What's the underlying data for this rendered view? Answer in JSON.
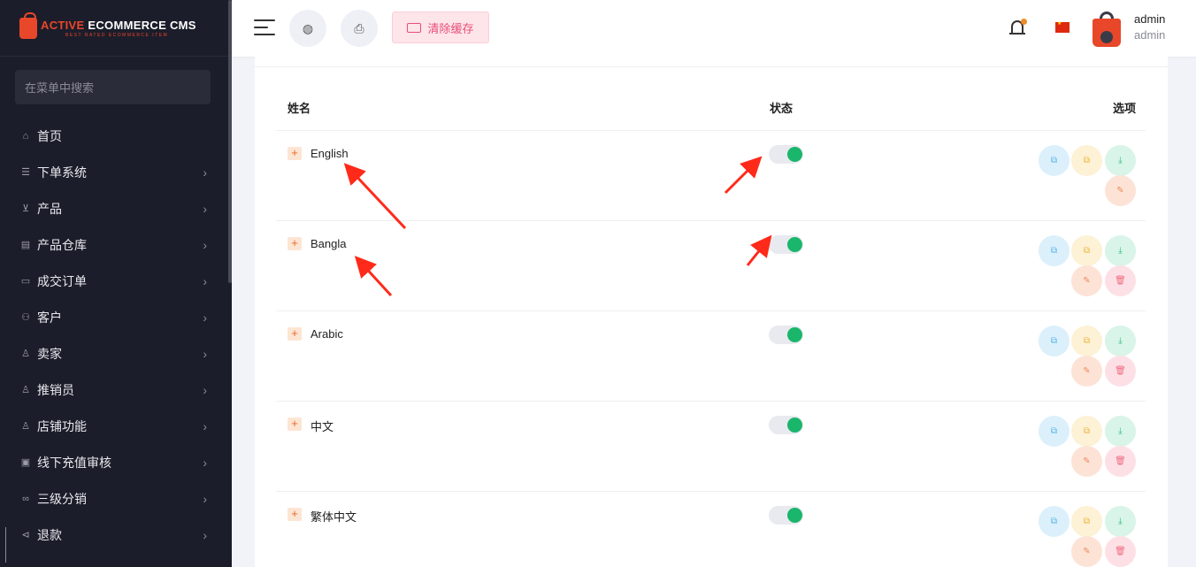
{
  "brand": {
    "title_part1": "ACTIVE ",
    "title_part2": "ECOMMERCE CMS",
    "subtitle": "BEST RATED ECOMMERCE ITEM"
  },
  "sidebar": {
    "search_placeholder": "在菜单中搜索",
    "items": [
      {
        "label": "首页",
        "icon": "home-icon",
        "has_children": false
      },
      {
        "label": "下单系统",
        "icon": "list-icon",
        "has_children": true
      },
      {
        "label": "产品",
        "icon": "cart-icon",
        "has_children": true
      },
      {
        "label": "产品仓库",
        "icon": "warehouse-icon",
        "has_children": true
      },
      {
        "label": "成交订单",
        "icon": "orders-icon",
        "has_children": true
      },
      {
        "label": "客户",
        "icon": "customers-icon",
        "has_children": true
      },
      {
        "label": "卖家",
        "icon": "user-icon",
        "has_children": true
      },
      {
        "label": "推销员",
        "icon": "user-icon",
        "has_children": true
      },
      {
        "label": "店铺功能",
        "icon": "user-icon",
        "has_children": true
      },
      {
        "label": "线下充值审核",
        "icon": "money-icon",
        "has_children": true
      },
      {
        "label": "三级分销",
        "icon": "link-icon",
        "has_children": true
      },
      {
        "label": "退款",
        "icon": "refund-icon",
        "has_children": true
      }
    ]
  },
  "header": {
    "cache_button": "清除缓存",
    "user": {
      "name": "admin",
      "role": "admin"
    }
  },
  "table": {
    "headers": {
      "name": "姓名",
      "status": "状态",
      "options": "选项"
    },
    "rows": [
      {
        "name": "English",
        "status_on": true,
        "deletable": false
      },
      {
        "name": "Bangla",
        "status_on": true,
        "deletable": true
      },
      {
        "name": "Arabic",
        "status_on": true,
        "deletable": true
      },
      {
        "name": "中文",
        "status_on": true,
        "deletable": true
      },
      {
        "name": "繁体中文",
        "status_on": true,
        "deletable": true
      }
    ]
  },
  "colors": {
    "sidebar_bg": "#1c1d2a",
    "brand_accent": "#e8472a",
    "toggle_on": "#1ab66b",
    "annotation_arrow": "#ff2a1a"
  }
}
